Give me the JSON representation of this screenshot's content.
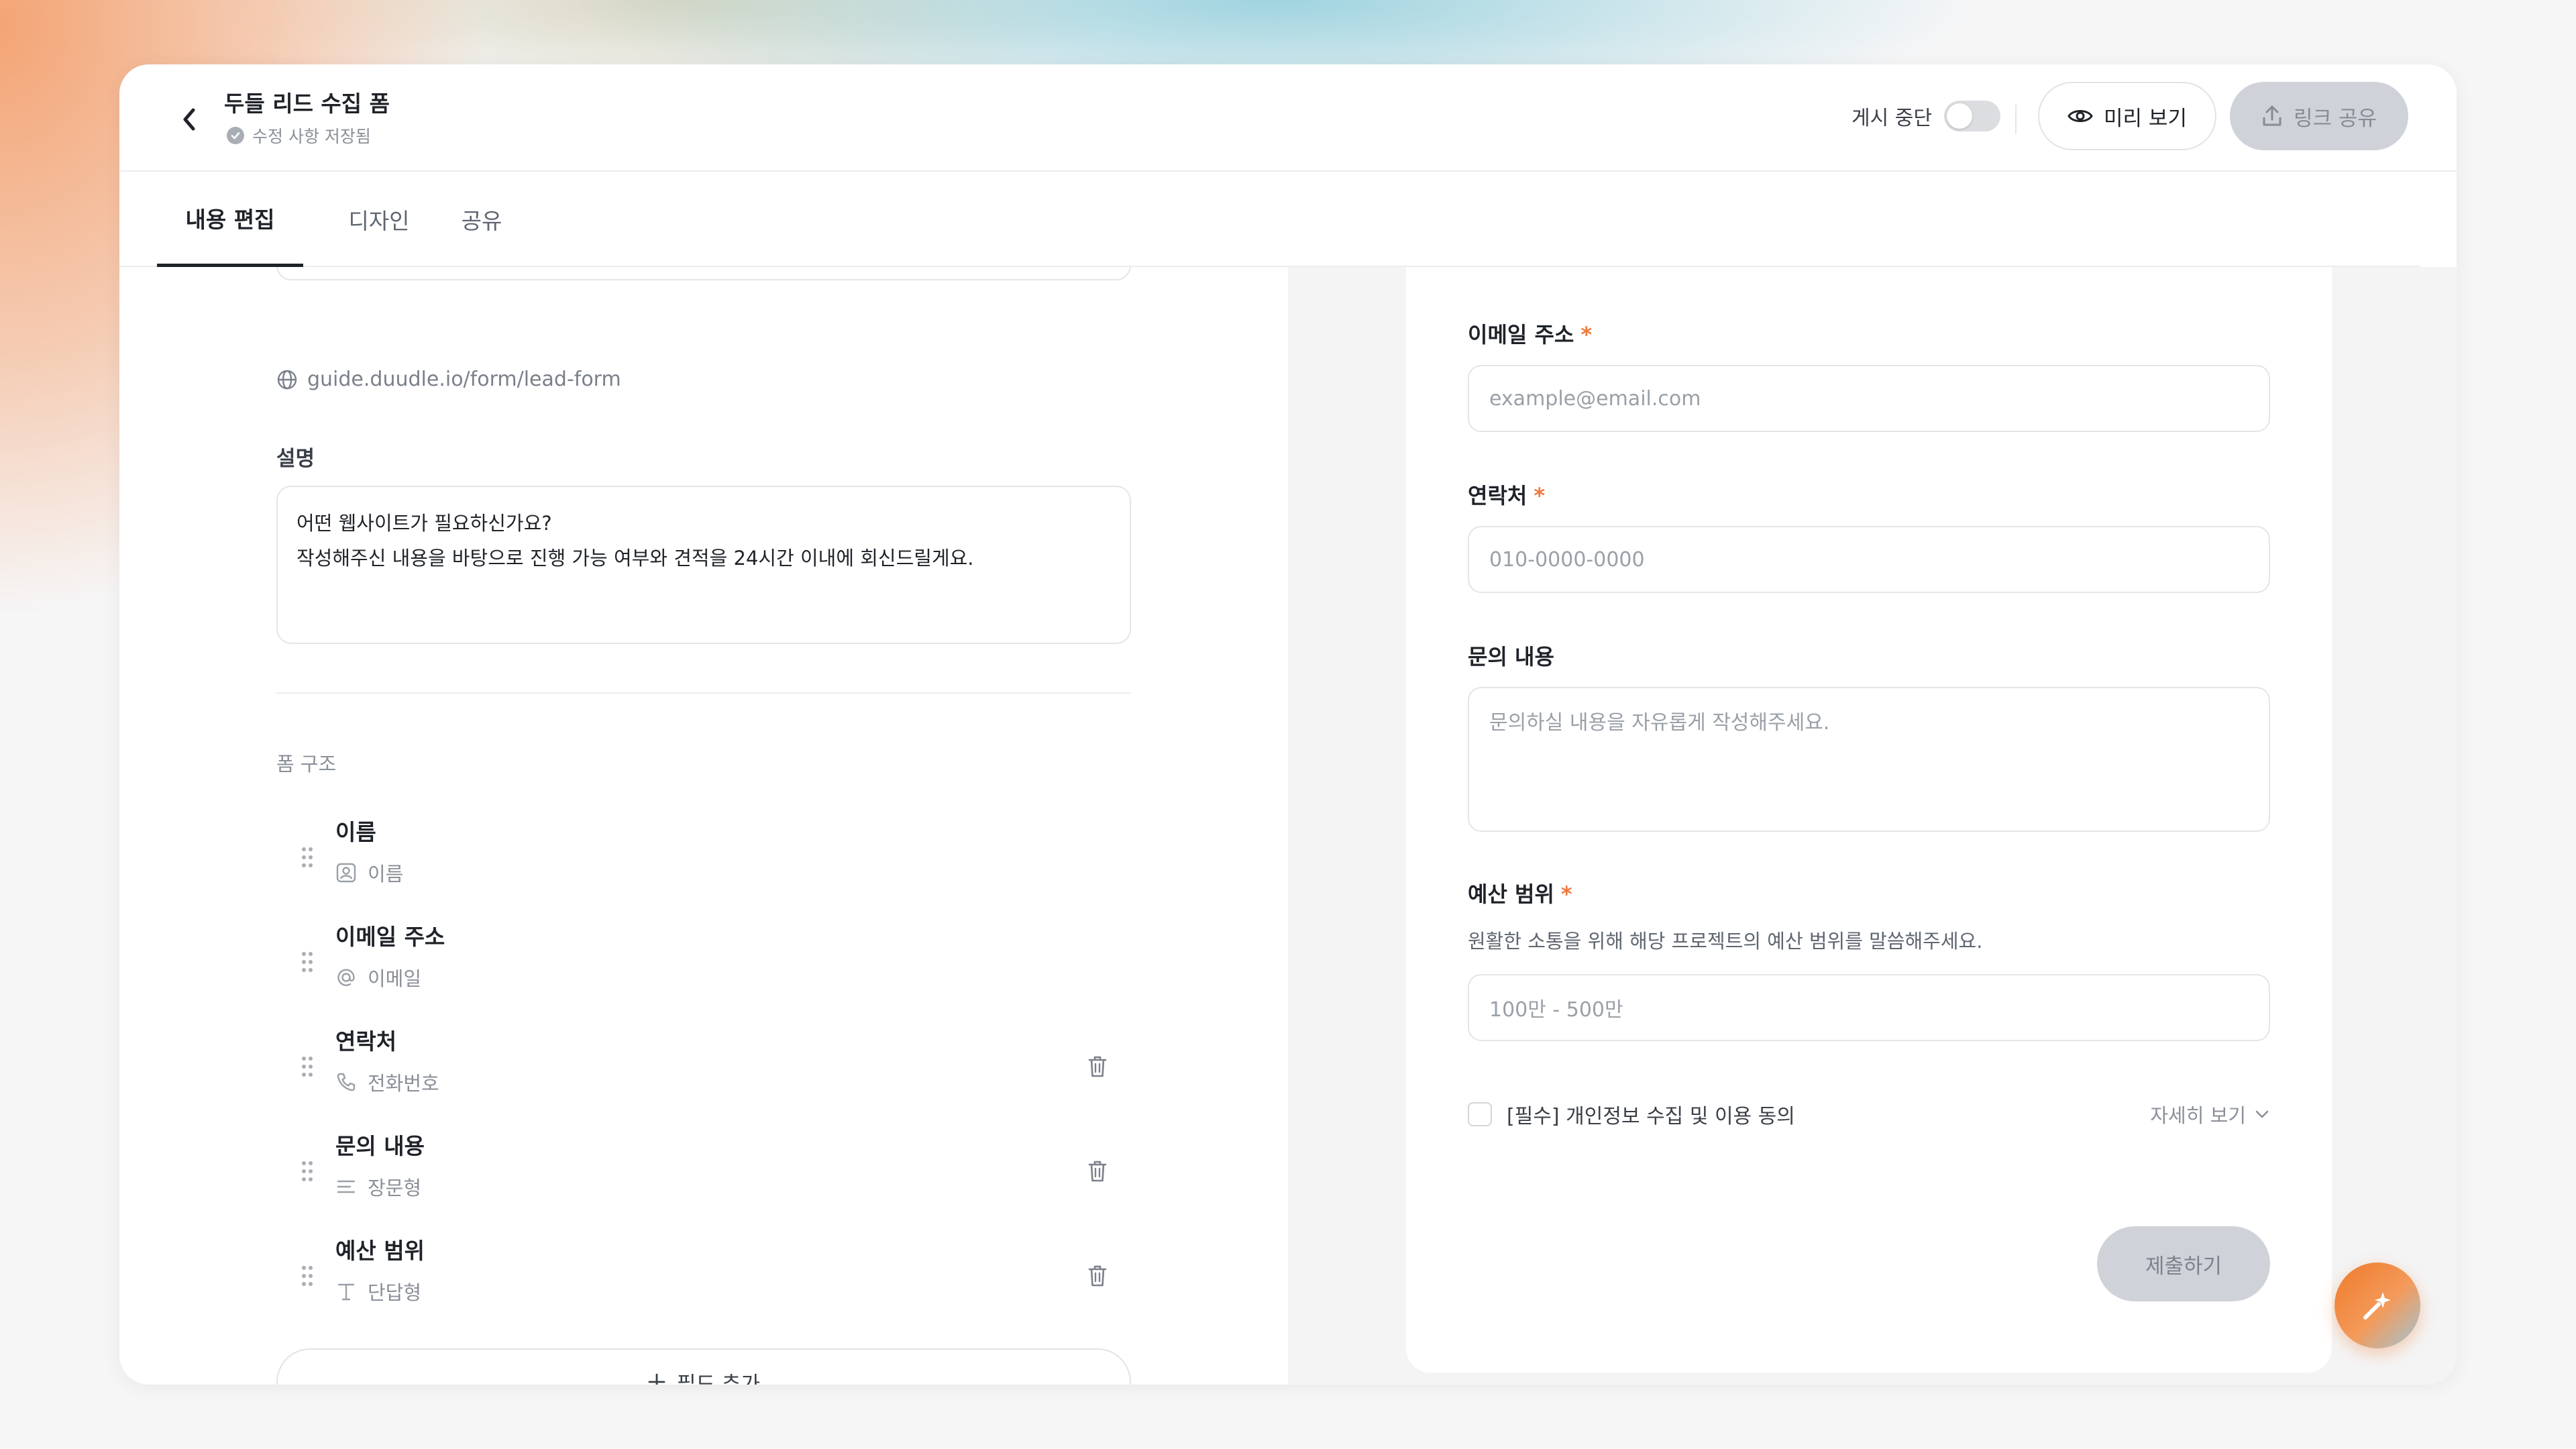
{
  "header": {
    "title": "두들 리드 수집 폼",
    "save_status": "수정 사항 저장됨",
    "publish_pause_label": "게시 중단",
    "preview_label": "미리 보기",
    "share_link_label": "링크 공유"
  },
  "tabs": [
    {
      "label": "내용 편집",
      "active": true
    },
    {
      "label": "디자인",
      "active": false
    },
    {
      "label": "공유",
      "active": false
    }
  ],
  "editor": {
    "form_url": "guide.duudle.io/form/lead-form",
    "description_label": "설명",
    "description_line1": "어떤 웹사이트가 필요하신가요?",
    "description_line2": "작성해주신 내용을 바탕으로 진행 가능 여부와 견적을 24시간 이내에 회신드릴게요.",
    "structure_label": "폼 구조",
    "fields": [
      {
        "name": "이름",
        "type": "이름",
        "icon": "person-icon",
        "deletable": false
      },
      {
        "name": "이메일 주소",
        "type": "이메일",
        "icon": "at-icon",
        "deletable": false
      },
      {
        "name": "연락처",
        "type": "전화번호",
        "icon": "phone-icon",
        "deletable": true
      },
      {
        "name": "문의 내용",
        "type": "장문형",
        "icon": "paragraph-icon",
        "deletable": true
      },
      {
        "name": "예산 범위",
        "type": "단답형",
        "icon": "text-icon",
        "deletable": true
      }
    ],
    "add_field_label": "필드 추가"
  },
  "preview": {
    "email_label": "이메일 주소",
    "email_placeholder": "example@email.com",
    "phone_label": "연락처",
    "phone_placeholder": "010-0000-0000",
    "inquiry_label": "문의 내용",
    "inquiry_placeholder": "문의하실 내용을 자유롭게 작성해주세요.",
    "budget_label": "예산 범위",
    "budget_help": "원활한 소통을 위해 해당 프로젝트의 예산 범위를 말씀해주세요.",
    "budget_placeholder": "100만 - 500만",
    "required_mark": "*",
    "consent_label": "[필수] 개인정보 수집 및 이용 동의",
    "details_label": "자세히 보기",
    "submit_label": "제출하기"
  },
  "colors": {
    "accent": "#f07a2c",
    "required": "#f07a3c",
    "disabled_button": "#cfd3d9"
  }
}
